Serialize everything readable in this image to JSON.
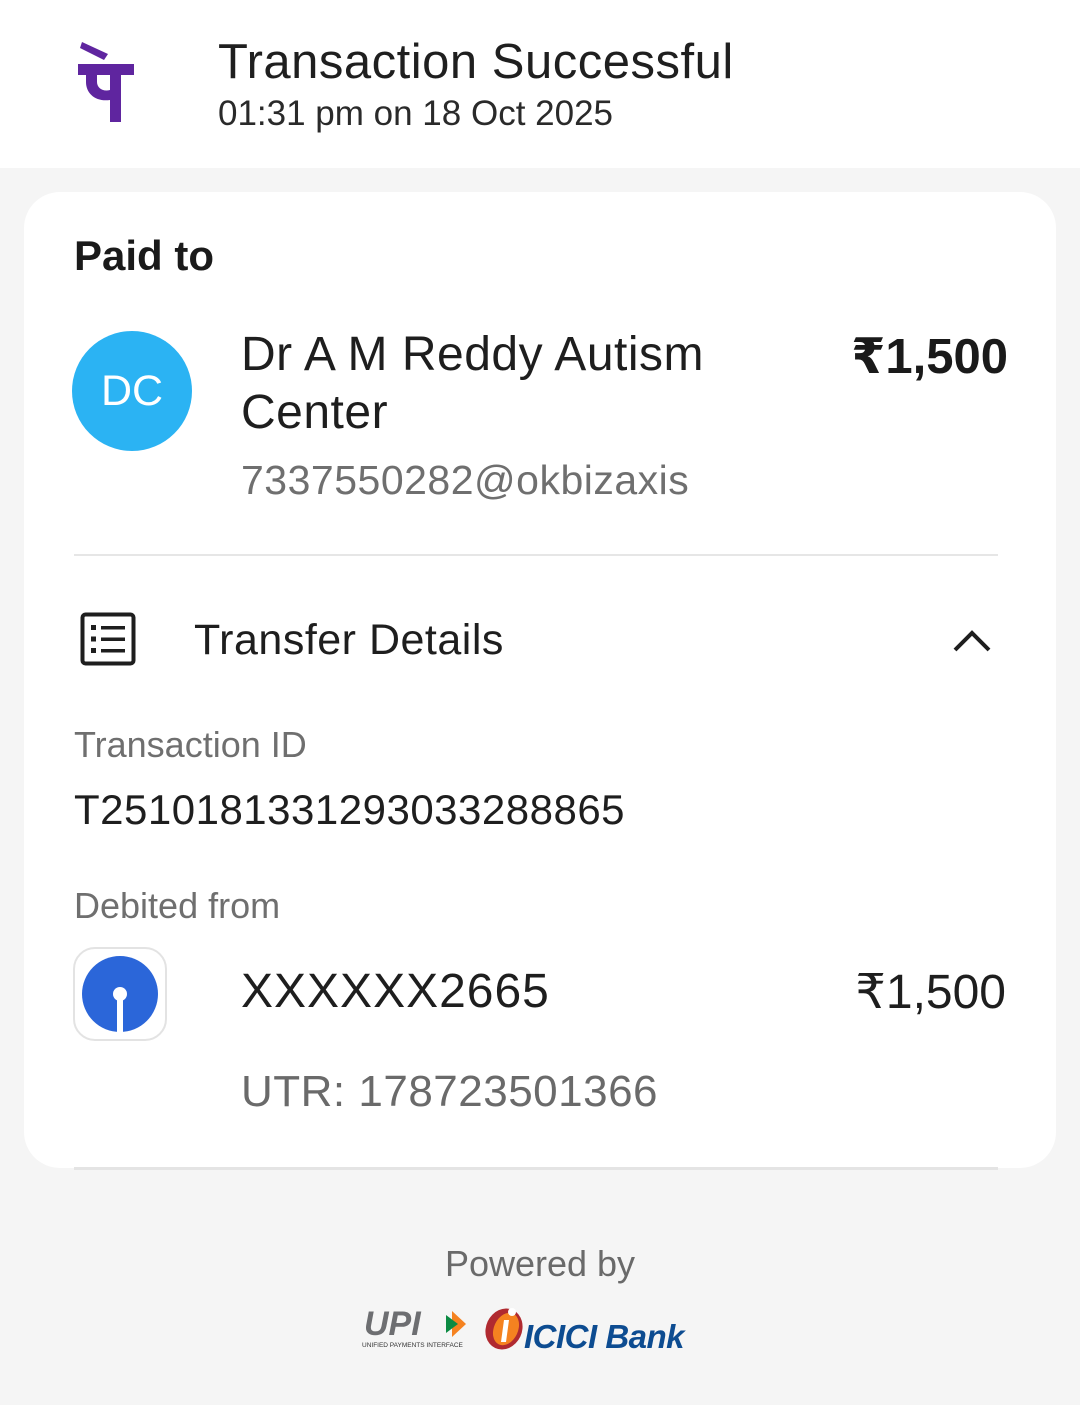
{
  "header": {
    "brand_icon": "phonepe-logo-icon",
    "title": "Transaction Successful",
    "timestamp": "01:31 pm on 18 Oct 2025"
  },
  "paid_to": {
    "label": "Paid to",
    "avatar_initials": "DC",
    "avatar_color": "#2bb3f3",
    "name": "Dr A M Reddy Autism Center",
    "upi_id": "7337550282@okbizaxis",
    "amount": "₹1,500"
  },
  "transfer_details": {
    "icon": "receipt-list-icon",
    "title": "Transfer Details",
    "toggle_icon": "chevron-up-icon",
    "transaction_id_label": "Transaction ID",
    "transaction_id": "T2510181331293033288865",
    "debited_from_label": "Debited from",
    "bank_icon": "sbi-logo-icon",
    "account_number": "XXXXXX2665",
    "debit_amount": "₹1,500",
    "utr": "UTR: 178723501366"
  },
  "footer": {
    "powered_by": "Powered by",
    "upi_logo_text": "UPI",
    "upi_tagline": "UNIFIED PAYMENTS INTERFACE",
    "bank_name": "ICICI Bank"
  },
  "colors": {
    "brand_purple": "#5f259f",
    "sbi_blue": "#2b66d9",
    "icici_blue": "#0d4c91",
    "icici_orange": "#f58220"
  }
}
